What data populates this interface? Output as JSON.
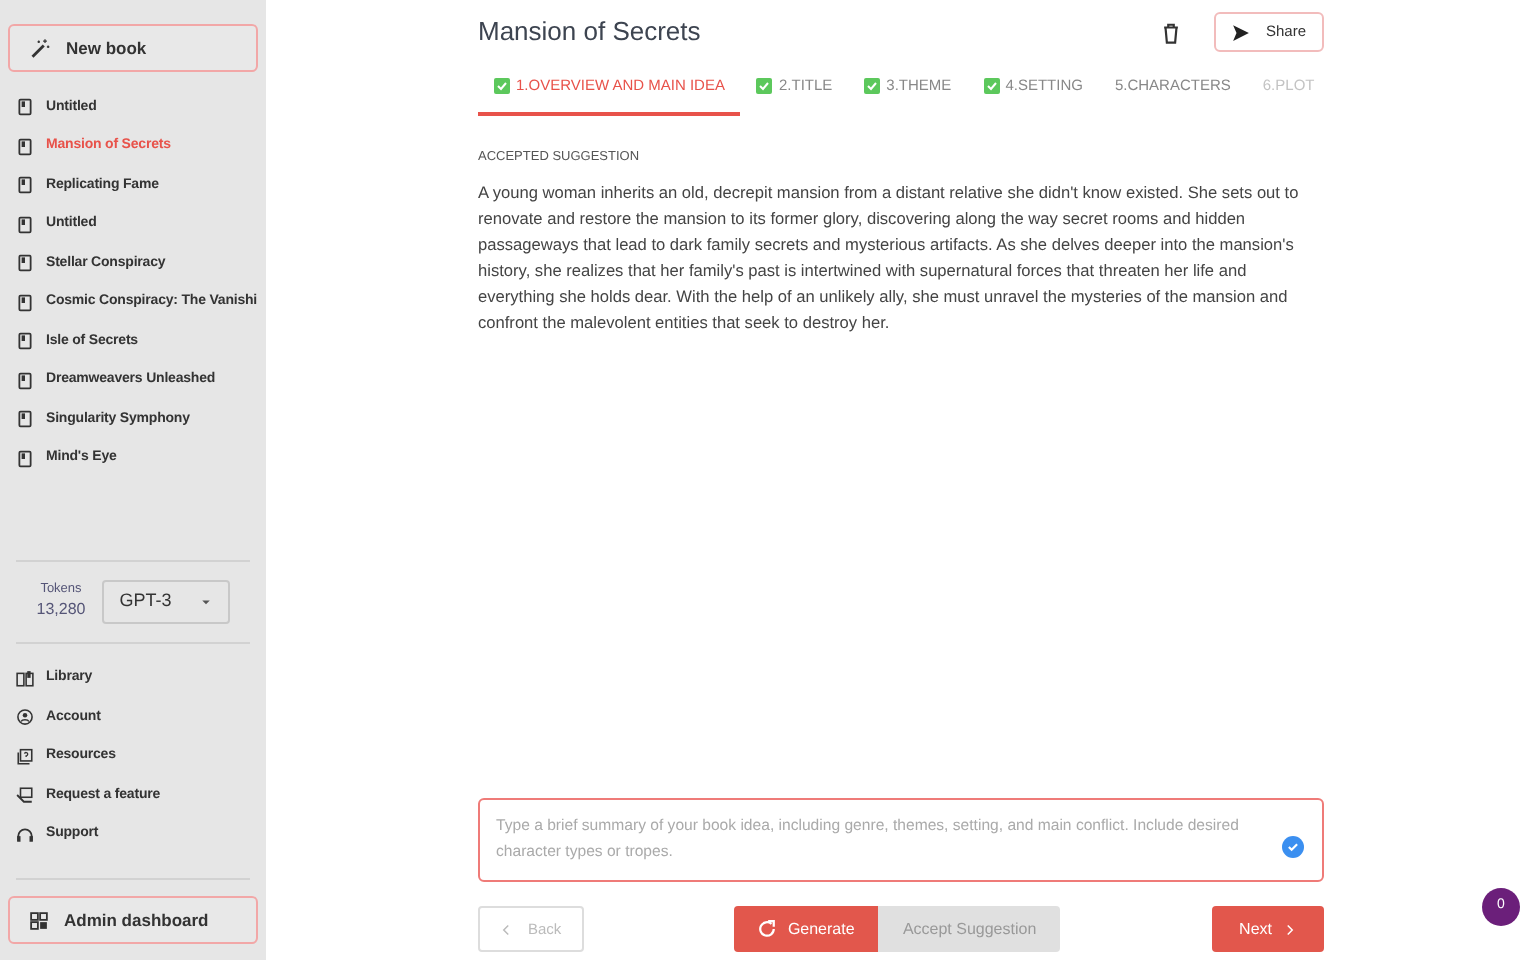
{
  "sidebar": {
    "new_book": "New book",
    "books": [
      {
        "title": "Untitled",
        "selected": false
      },
      {
        "title": "Mansion of Secrets",
        "selected": true
      },
      {
        "title": "Replicating Fame",
        "selected": false
      },
      {
        "title": "Untitled",
        "selected": false
      },
      {
        "title": "Stellar Conspiracy",
        "selected": false
      },
      {
        "title": "Cosmic Conspiracy: The Vanishi",
        "selected": false
      },
      {
        "title": "Isle of Secrets",
        "selected": false
      },
      {
        "title": "Dreamweavers Unleashed",
        "selected": false
      },
      {
        "title": "Singularity Symphony",
        "selected": false
      },
      {
        "title": "Mind's Eye",
        "selected": false
      }
    ],
    "tokens_label": "Tokens",
    "tokens_value": "13,280",
    "model": "GPT-3",
    "links": [
      {
        "label": "Library",
        "kind": "library"
      },
      {
        "label": "Account",
        "kind": "account"
      },
      {
        "label": "Resources",
        "kind": "resources"
      },
      {
        "label": "Request a feature",
        "kind": "request"
      },
      {
        "label": "Support",
        "kind": "support"
      }
    ],
    "admin": "Admin dashboard"
  },
  "header": {
    "title": "Mansion of Secrets",
    "share": "Share"
  },
  "tabs": [
    {
      "label": "1.OVERVIEW AND MAIN IDEA",
      "done": true,
      "selected": true,
      "disabled": false
    },
    {
      "label": "2.TITLE",
      "done": true,
      "selected": false,
      "disabled": false
    },
    {
      "label": "3.THEME",
      "done": true,
      "selected": false,
      "disabled": false
    },
    {
      "label": "4.SETTING",
      "done": true,
      "selected": false,
      "disabled": false
    },
    {
      "label": "5.CHARACTERS",
      "done": false,
      "selected": false,
      "disabled": false
    },
    {
      "label": "6.PLOT",
      "done": false,
      "selected": false,
      "disabled": true
    }
  ],
  "suggestion": {
    "heading": "ACCEPTED SUGGESTION",
    "text": "A young woman inherits an old, decrepit mansion from a distant relative she didn't know existed. She sets out to renovate and restore the mansion to its former glory, discovering along the way secret rooms and hidden passageways that lead to dark family secrets and mysterious artifacts. As she delves deeper into the mansion's history, she realizes that her family's past is intertwined with supernatural forces that threaten her life and everything she holds dear. With the help of an unlikely ally, she must unravel the mysteries of the mansion and confront the malevolent entities that seek to destroy her."
  },
  "prompt": {
    "placeholder": "Type a brief summary of your book idea, including genre, themes, setting, and main conflict. Include desired character types or tropes."
  },
  "buttons": {
    "back": {
      "label": "Back",
      "disabled": true
    },
    "generate": {
      "label": "Generate",
      "disabled": false
    },
    "accept": {
      "label": "Accept Suggestion",
      "disabled": true
    },
    "next": {
      "label": "Next",
      "disabled": false
    }
  },
  "notification_count": "0"
}
